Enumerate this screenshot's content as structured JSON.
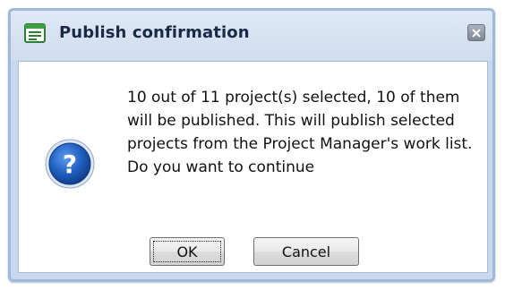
{
  "dialog": {
    "title": "Publish confirmation",
    "message": "10 out of 11 project(s) selected, 10 of them will be published. This will publish selected projects from the Project Manager's work list. Do you want to continue",
    "icons": {
      "title": "form-window-icon",
      "close": "close-icon",
      "message": "question-mark-icon"
    },
    "buttons": {
      "ok": "OK",
      "cancel": "Cancel"
    },
    "colors": {
      "title_bar": "#cfdcee",
      "question_icon": "#1f5fbf"
    }
  }
}
